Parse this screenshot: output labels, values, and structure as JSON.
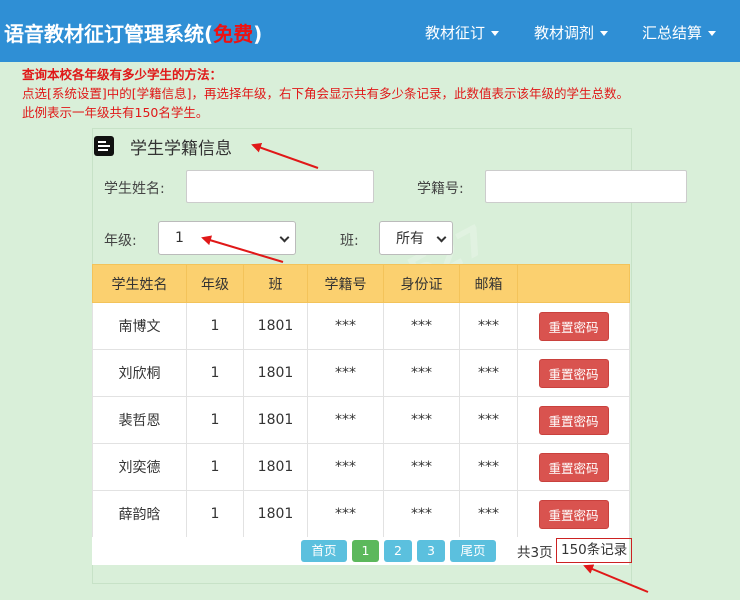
{
  "header": {
    "title_main": "语音教材征订管理系统(",
    "title_free": "免费",
    "title_end": ")",
    "menus": [
      {
        "label": "教材征订"
      },
      {
        "label": "教材调剂"
      },
      {
        "label": "汇总结算"
      }
    ]
  },
  "notes": {
    "title": "查询本校各年级有多少学生的方法：",
    "line1": "点选[系统设置]中的[学籍信息]，再选择年级，右下角会显示共有多少条记录，此数值表示该年级的学生总数。",
    "line2": "此例表示一年级共有150名学生。"
  },
  "panel": {
    "title": "学生学籍信息"
  },
  "filters": {
    "name_label": "学生姓名:",
    "name_value": "",
    "id_label": "学籍号:",
    "id_value": "",
    "grade_label": "年级:",
    "grade_value": "1",
    "class_label": "班:",
    "class_value": "所有"
  },
  "table": {
    "headers": [
      "学生姓名",
      "年级",
      "班",
      "学籍号",
      "身份证",
      "邮箱",
      ""
    ],
    "rows": [
      [
        "南博文",
        "1",
        "1801",
        "***",
        "***",
        "***"
      ],
      [
        "刘欣桐",
        "1",
        "1801",
        "***",
        "***",
        "***"
      ],
      [
        "裴哲恩",
        "1",
        "1801",
        "***",
        "***",
        "***"
      ],
      [
        "刘奕德",
        "1",
        "1801",
        "***",
        "***",
        "***"
      ],
      [
        "薛韵晗",
        "1",
        "1801",
        "***",
        "***",
        "***"
      ]
    ],
    "action_label": "重置密码"
  },
  "pager": {
    "first": "首页",
    "pages": [
      "1",
      "2",
      "3"
    ],
    "last": "尾页",
    "total_pages": "共3页",
    "total_records": "150条记录"
  },
  "colors": {
    "navbar": "#2f8fd5",
    "accent_red": "#e01818",
    "table_header": "#fbd06f",
    "danger_button": "#d9534f",
    "pager_blue": "#5bc0de",
    "pager_green": "#5cb85c",
    "background": "#d9efd9"
  }
}
